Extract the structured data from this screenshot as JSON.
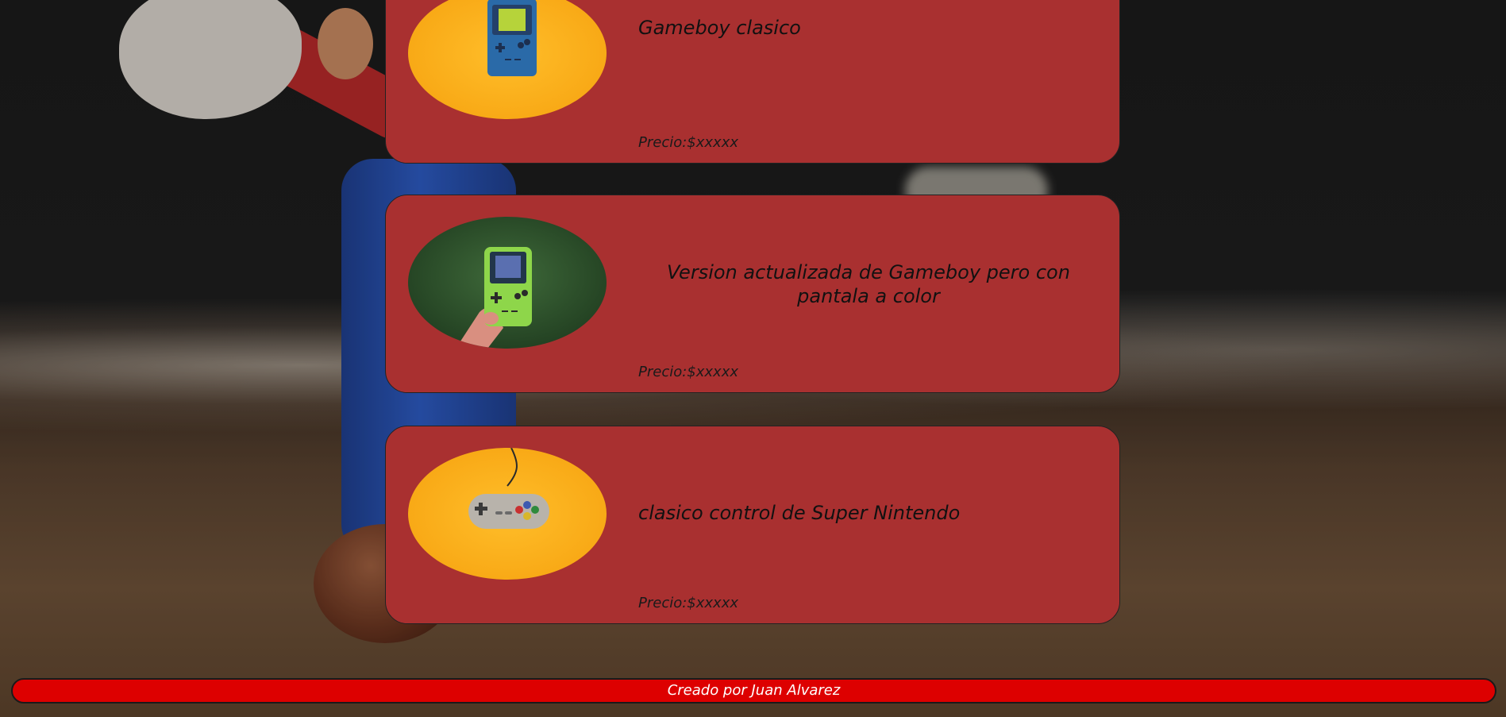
{
  "products": [
    {
      "title": "Gameboy clasico",
      "price": "Precio:$xxxxx",
      "image_icon": "gameboy-classic-photo"
    },
    {
      "title": "Version actualizada de Gameboy pero con pantala a color",
      "price": "Precio:$xxxxx",
      "image_icon": "gameboy-color-photo"
    },
    {
      "title": "clasico control de Super Nintendo",
      "price": "Precio:$xxxxx",
      "image_icon": "snes-controller-photo"
    }
  ],
  "footer": {
    "text": "Creado por Juan Alvarez"
  },
  "colors": {
    "card_bg": "#a93030",
    "footer_bg": "#dd0000",
    "text": "#111111"
  }
}
